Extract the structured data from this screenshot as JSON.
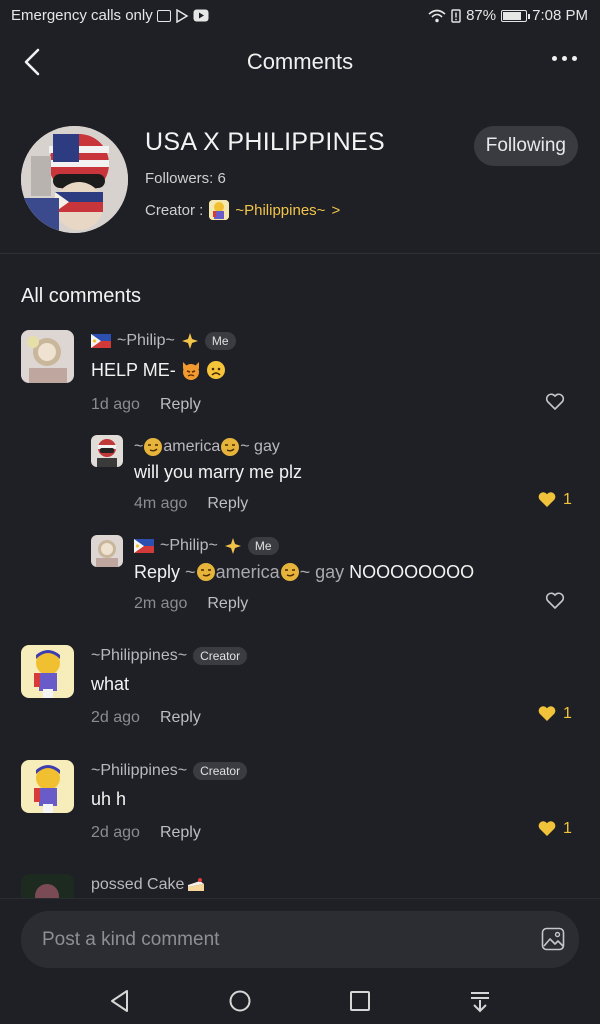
{
  "status_bar": {
    "left_text": "Emergency calls only",
    "battery": "87%",
    "battery_level": 0.87,
    "time": "7:08 PM"
  },
  "header": {
    "title": "Comments"
  },
  "profile": {
    "name": "USA X PHILIPPINES",
    "followers": "Followers: 6",
    "creator_label": "Creator :",
    "creator_name": "~Philippines~",
    "creator_chevron": ">",
    "follow_button": "Following"
  },
  "section_title": "All comments",
  "comments": [
    {
      "author": "~Philip~",
      "badge": "Me",
      "text": "HELP ME-",
      "time": "1d ago",
      "reply": "Reply"
    },
    {
      "author_prefix": "~",
      "author_core": "america",
      "author_suffix": "~ gay",
      "text": "will you marry me plz",
      "time": "4m ago",
      "reply": "Reply",
      "likes": "1"
    },
    {
      "author": "~Philip~",
      "badge": "Me",
      "text_prefix": "Reply",
      "quote_prefix": "~",
      "quote_core": "america",
      "quote_suffix": "~ gay",
      "text_tail": "NOOOOOOOO",
      "time": "2m ago",
      "reply": "Reply"
    },
    {
      "author": "~Philippines~",
      "badge": "Creator",
      "text": "what",
      "time": "2d ago",
      "reply": "Reply",
      "likes": "1"
    },
    {
      "author": "~Philippines~",
      "badge": "Creator",
      "text": "uh h",
      "time": "2d ago",
      "reply": "Reply",
      "likes": "1"
    },
    {
      "author": "possed Cake"
    }
  ],
  "input": {
    "placeholder": "Post a kind comment"
  },
  "colors": {
    "background": "#1f2025",
    "accent_gold": "#f2c54a",
    "like_gold": "#f0c33a"
  }
}
